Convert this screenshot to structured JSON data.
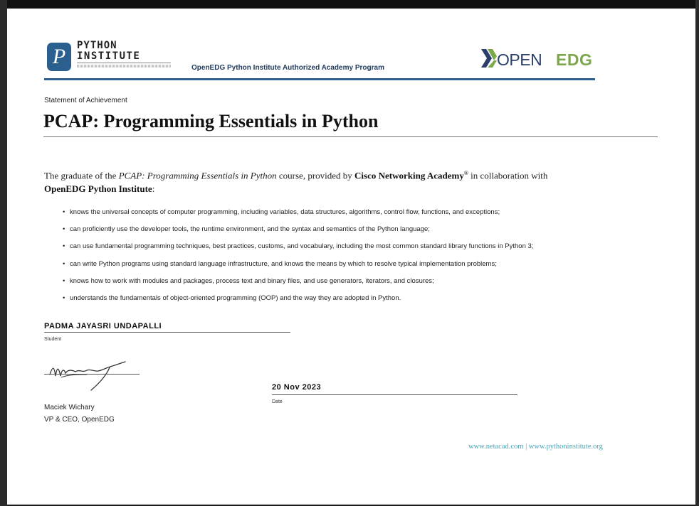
{
  "header": {
    "logo_letter": "P",
    "institute_line1": "PYTHON",
    "institute_line2": "INSTITUTE",
    "academy_program": "OpenEDG Python Institute Authorized Academy Program",
    "openedg_open": "OPEN",
    "openedg_edg": "EDG"
  },
  "certificate": {
    "statement_label": "Statement of Achievement",
    "title": "PCAP: Programming Essentials in Python",
    "intro": {
      "lead": "The graduate of the ",
      "course_name": "PCAP: Programming Essentials in Python",
      "mid": " course, provided by ",
      "provider": "Cisco Networking Academy",
      "reg_mark": "®",
      "collab": " in collaboration with ",
      "partner": "OpenEDG Python Institute",
      "end": ":"
    },
    "bullets": [
      "knows the universal concepts of computer programming, including variables, data structures, algorithms, control flow, functions, and exceptions;",
      "can proficiently use the developer tools, the runtime environment, and the syntax and semantics of the Python language;",
      "can use fundamental programming techniques, best practices, customs, and vocabulary, including the most common standard library functions in Python 3;",
      "can write Python programs using standard language infrastructure, and knows the means by which to resolve typical implementation problems;",
      "knows how to work with modules and packages, process text and binary files, and use generators, iterators, and closures;",
      "understands the fundamentals of object-oriented programming (OOP) and the way they are adopted in Python."
    ]
  },
  "student": {
    "name": "PADMA JAYASRI UNDAPALLI",
    "label": "Student"
  },
  "signer": {
    "name": "Maciek Wichary",
    "title": "VP & CEO, OpenEDG"
  },
  "date": {
    "value": "20 Nov 2023",
    "label": "Date"
  },
  "footer": {
    "urls": "www.netacad.com | www.pythoninstitute.org"
  },
  "colors": {
    "brand_blue": "#2b5f8e",
    "openedg_navy": "#2a3f6b",
    "openedg_green": "#7ba84a",
    "url_teal": "#4aa3b5"
  }
}
